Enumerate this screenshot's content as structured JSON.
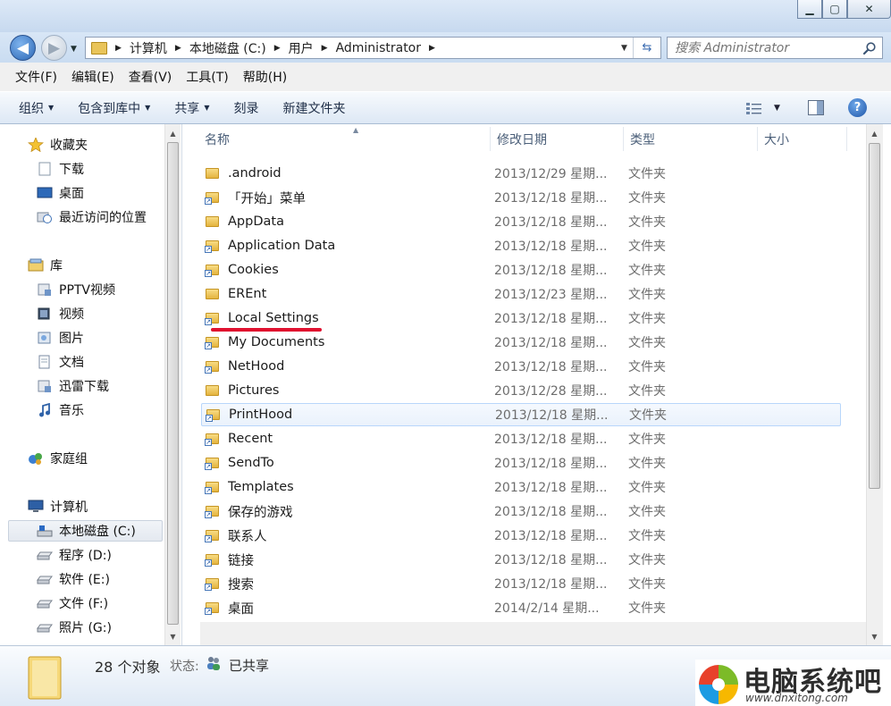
{
  "window": {
    "minimize_glyph": "▁",
    "maximize_glyph": "▢",
    "close_glyph": "✕"
  },
  "address": {
    "crumbs": [
      "计算机",
      "本地磁盘 (C:)",
      "用户",
      "Administrator"
    ],
    "search_placeholder": "搜索 Administrator"
  },
  "menu": [
    "文件(F)",
    "编辑(E)",
    "查看(V)",
    "工具(T)",
    "帮助(H)"
  ],
  "commands": {
    "organize": "组织",
    "include_library": "包含到库中",
    "share": "共享",
    "burn": "刻录",
    "new_folder": "新建文件夹",
    "help": "?"
  },
  "nav": {
    "favorites": "收藏夹",
    "downloads": "下载",
    "desktop": "桌面",
    "recent": "最近访问的位置",
    "libraries": "库",
    "pptv": "PPTV视频",
    "videos": "视频",
    "pictures": "图片",
    "documents": "文档",
    "thunder": "迅雷下载",
    "music": "音乐",
    "homegroup": "家庭组",
    "computer": "计算机",
    "drive_c": "本地磁盘 (C:)",
    "drive_d": "程序 (D:)",
    "drive_e": "软件 (E:)",
    "drive_f": "文件 (F:)",
    "drive_g": "照片 (G:)"
  },
  "columns": {
    "name": "名称",
    "date": "修改日期",
    "type": "类型",
    "size": "大小"
  },
  "files": [
    {
      "name": ".android",
      "date": "2013/12/29 星期...",
      "type": "文件夹",
      "icon": "folder-icon"
    },
    {
      "name": "「开始」菜单",
      "date": "2013/12/18 星期...",
      "type": "文件夹",
      "icon": "shortcut-folder-icon"
    },
    {
      "name": "AppData",
      "date": "2013/12/18 星期...",
      "type": "文件夹",
      "icon": "folder-icon"
    },
    {
      "name": "Application Data",
      "date": "2013/12/18 星期...",
      "type": "文件夹",
      "icon": "shortcut-folder-icon"
    },
    {
      "name": "Cookies",
      "date": "2013/12/18 星期...",
      "type": "文件夹",
      "icon": "shortcut-folder-icon"
    },
    {
      "name": "EREnt",
      "date": "2013/12/23 星期...",
      "type": "文件夹",
      "icon": "folder-icon"
    },
    {
      "name": "Local Settings",
      "date": "2013/12/18 星期...",
      "type": "文件夹",
      "icon": "shortcut-folder-icon"
    },
    {
      "name": "My Documents",
      "date": "2013/12/18 星期...",
      "type": "文件夹",
      "icon": "shortcut-folder-icon"
    },
    {
      "name": "NetHood",
      "date": "2013/12/18 星期...",
      "type": "文件夹",
      "icon": "shortcut-folder-icon"
    },
    {
      "name": "Pictures",
      "date": "2013/12/28 星期...",
      "type": "文件夹",
      "icon": "folder-icon"
    },
    {
      "name": "PrintHood",
      "date": "2013/12/18 星期...",
      "type": "文件夹",
      "icon": "shortcut-folder-icon"
    },
    {
      "name": "Recent",
      "date": "2013/12/18 星期...",
      "type": "文件夹",
      "icon": "shortcut-folder-icon"
    },
    {
      "name": "SendTo",
      "date": "2013/12/18 星期...",
      "type": "文件夹",
      "icon": "shortcut-folder-icon"
    },
    {
      "name": "Templates",
      "date": "2013/12/18 星期...",
      "type": "文件夹",
      "icon": "shortcut-folder-icon"
    },
    {
      "name": "保存的游戏",
      "date": "2013/12/18 星期...",
      "type": "文件夹",
      "icon": "saved-games-icon"
    },
    {
      "name": "联系人",
      "date": "2013/12/18 星期...",
      "type": "文件夹",
      "icon": "contacts-icon"
    },
    {
      "name": "链接",
      "date": "2013/12/18 星期...",
      "type": "文件夹",
      "icon": "links-icon"
    },
    {
      "name": "搜索",
      "date": "2013/12/18 星期...",
      "type": "文件夹",
      "icon": "searches-icon"
    },
    {
      "name": "桌面",
      "date": "2014/2/14 星期...",
      "type": "文件夹",
      "icon": "desktop-folder-icon"
    }
  ],
  "details": {
    "count": "28 个对象",
    "status_label": "状态:",
    "status_value": "已共享"
  },
  "watermark": {
    "title": "电脑系统吧",
    "url": "www.dnxitong.com"
  },
  "colors": {
    "accent": "#2c67b5",
    "highlight_underline": "#e0102f"
  }
}
